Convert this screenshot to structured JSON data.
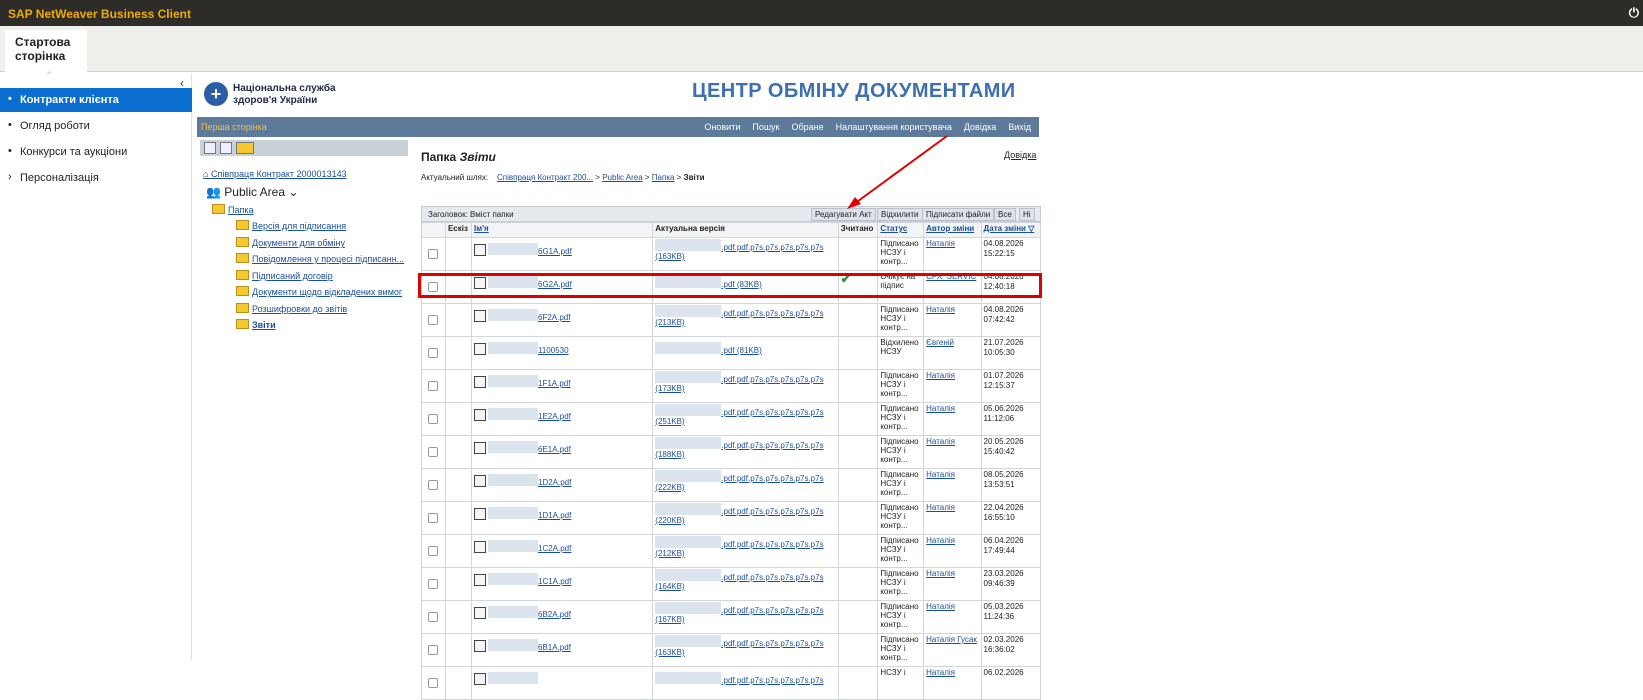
{
  "app": {
    "title": "SAP NetWeaver Business Client",
    "home_tab": "Стартова сторінка"
  },
  "sidebar": {
    "items": [
      {
        "label": "Контракти клієнта",
        "bullet": "•"
      },
      {
        "label": "Огляд роботи",
        "bullet": "•"
      },
      {
        "label": "Конкурси та аукціони",
        "bullet": "•"
      },
      {
        "label": "Персоналізація",
        "bullet": "›"
      }
    ]
  },
  "header": {
    "logo_text": "Національна служба здоров'я України",
    "headline": "ЦЕНТР ОБМІНУ ДОКУМЕНТАМИ"
  },
  "nav": {
    "first": "Перша сторінка",
    "links": [
      "Оновити",
      "Пошук",
      "Обране",
      "Налаштування користувача",
      "Довідка",
      "Вихід"
    ]
  },
  "tree": {
    "contract": "Співпраця Контракт 2000013143",
    "area": "Public Area",
    "root": "Папка",
    "folders": [
      "Версія для підписання",
      "Документи для обміну",
      "Повідомлення у процесі підписанн...",
      "Підписаний договір",
      "Документи щодо відкладених вимог",
      "Розшифровки до звітів",
      "Звіти"
    ]
  },
  "main": {
    "title_prefix": "Папка",
    "title_name": "Звіти",
    "help": "Довідка",
    "breadcrumb_label": "Актуальний шлях:",
    "breadcrumb": [
      "Співпраця Контракт 200...",
      "Public Area",
      "Папка",
      "Звіти"
    ],
    "caption": "Заголовок: Вміст папки",
    "buttons": [
      "Редагувати Акт",
      "Відхилити",
      "Підписати файли",
      "Все",
      "Ні"
    ],
    "columns": [
      "Ескіз",
      "Ім'я",
      "Актуальна версія",
      "Зчитано",
      "Статус",
      "Автор зміни",
      "Дата зміни"
    ]
  },
  "rows": [
    {
      "name": "6G1A.pdf",
      "version": ".pdf.pdf.p7s.p7s.p7s.p7s.p7s",
      "size": "(163KB)",
      "read": "",
      "status": [
        "Підписано",
        "НСЗУ і",
        "контр..."
      ],
      "author": "Наталія",
      "date": "04.08.2026",
      "time": "15:22:15"
    },
    {
      "name": "6G2A.pdf",
      "version": ".pdf (83KB)",
      "size": "",
      "read": "✔",
      "status": [
        "Очікує на",
        "підпис"
      ],
      "author": "CFX_SERVIC",
      "date": "04.08.2026",
      "time": "12:40:18"
    },
    {
      "name": "6F2A.pdf",
      "version": ".pdf.pdf.p7s.p7s.p7s.p7s.p7s",
      "size": "(213KB)",
      "read": "",
      "status": [
        "Підписано",
        "НСЗУ і",
        "контр..."
      ],
      "author": "Наталія",
      "date": "04.08.2026",
      "time": "07:42:42"
    },
    {
      "name": "1100530",
      "version": ".pdf (81KB)",
      "size": "",
      "read": "",
      "status": [
        "Відхилено",
        "НСЗУ"
      ],
      "author": "Євгеній",
      "date": "21.07.2026",
      "time": "10:05:30"
    },
    {
      "name": "1F1A.pdf",
      "version": ".pdf.pdf.p7s.p7s.p7s.p7s.p7s",
      "size": "(173KB)",
      "read": "",
      "status": [
        "Підписано",
        "НСЗУ і",
        "контр..."
      ],
      "author": "Наталія",
      "date": "01.07.2026",
      "time": "12:15:37"
    },
    {
      "name": "1E2A.pdf",
      "version": ".pdf.pdf.p7s.p7s.p7s.p7s.p7s",
      "size": "(251KB)",
      "read": "",
      "status": [
        "Підписано",
        "НСЗУ і",
        "контр..."
      ],
      "author": "Наталія",
      "date": "05.06.2026",
      "time": "11:12:06"
    },
    {
      "name": "6E1A.pdf",
      "version": ".pdf.pdf.p7s.p7s.p7s.p7s.p7s",
      "size": "(188KB)",
      "read": "",
      "status": [
        "Підписано",
        "НСЗУ і",
        "контр..."
      ],
      "author": "Наталія",
      "date": "20.05.2026",
      "time": "15:40:42"
    },
    {
      "name": "1D2A.pdf",
      "version": ".pdf.pdf.p7s.p7s.p7s.p7s.p7s",
      "size": "(222KB)",
      "read": "",
      "status": [
        "Підписано",
        "НСЗУ і",
        "контр..."
      ],
      "author": "Наталія",
      "date": "08.05.2026",
      "time": "13:53:51"
    },
    {
      "name": "1D1A.pdf",
      "version": ".pdf.pdf.p7s.p7s.p7s.p7s.p7s",
      "size": "(220KB)",
      "read": "",
      "status": [
        "Підписано",
        "НСЗУ і",
        "контр..."
      ],
      "author": "Наталія",
      "date": "22.04.2026",
      "time": "16:55:10"
    },
    {
      "name": "1C2A.pdf",
      "version": ".pdf.pdf.p7s.p7s.p7s.p7s.p7s",
      "size": "(212KB)",
      "read": "",
      "status": [
        "Підписано",
        "НСЗУ і",
        "контр..."
      ],
      "author": "Наталія",
      "date": "06.04.2026",
      "time": "17:49:44"
    },
    {
      "name": "1C1A.pdf",
      "version": ".pdf.pdf.p7s.p7s.p7s.p7s.p7s",
      "size": "(164KB)",
      "read": "",
      "status": [
        "Підписано",
        "НСЗУ і",
        "контр..."
      ],
      "author": "Наталія",
      "date": "23.03.2026",
      "time": "09:46:39"
    },
    {
      "name": "6B2A.pdf",
      "version": ".pdf.pdf.p7s.p7s.p7s.p7s.p7s",
      "size": "(167KB)",
      "read": "",
      "status": [
        "Підписано",
        "НСЗУ і",
        "контр..."
      ],
      "author": "Наталія",
      "date": "05.03.2026",
      "time": "11:24:36"
    },
    {
      "name": "6B1A.pdf",
      "version": ".pdf.pdf.p7s.p7s.p7s.p7s.p7s",
      "size": "(163KB)",
      "read": "",
      "status": [
        "Підписано",
        "НСЗУ і",
        "контр..."
      ],
      "author": "Наталія Гусак",
      "date": "02.03.2026",
      "time": "16:36:02"
    },
    {
      "name": "",
      "version": ".pdf.pdf.p7s.p7s.p7s.p7s.p7s",
      "size": "",
      "read": "",
      "status": [
        "НСЗУ і"
      ],
      "author": "Наталія",
      "date": "06.02.2026",
      "time": ""
    }
  ]
}
